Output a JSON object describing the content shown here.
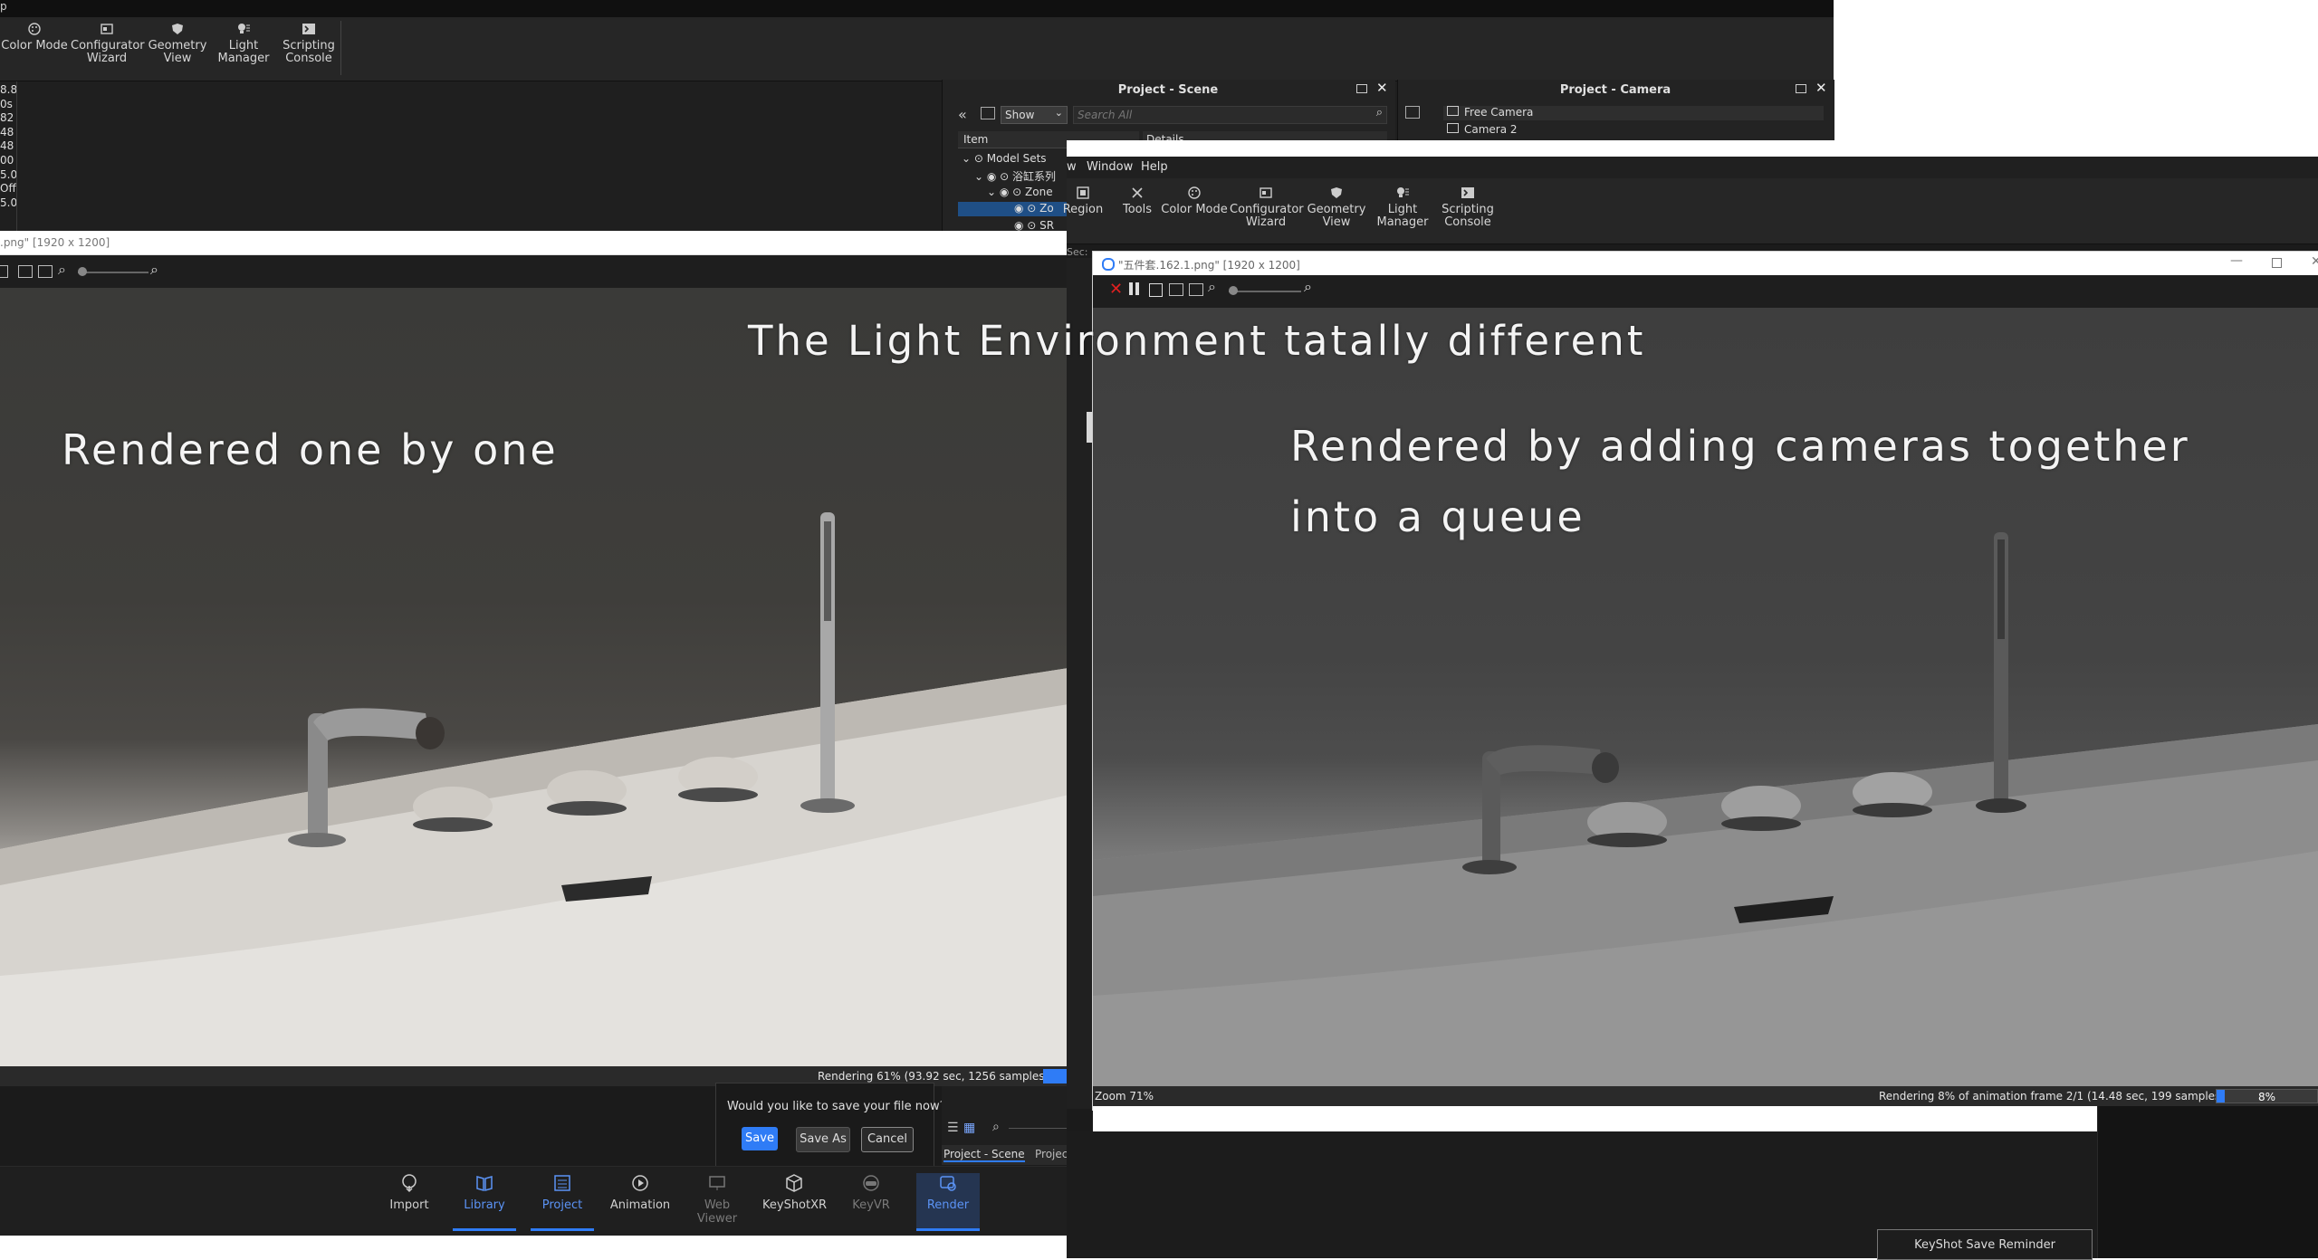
{
  "left_window": {
    "menu_fragment": "p",
    "ribbon": [
      {
        "label_1": "Color Mode",
        "label_2": "",
        "icon": "palette-icon"
      },
      {
        "label_1": "Configurator",
        "label_2": "Wizard",
        "icon": "wizard-icon"
      },
      {
        "label_1": "Geometry",
        "label_2": "View",
        "icon": "shield-icon"
      },
      {
        "label_1": "Light",
        "label_2": "Manager",
        "icon": "light-icon"
      },
      {
        "label_1": "Scripting",
        "label_2": "Console",
        "icon": "console-icon"
      }
    ],
    "side_values": [
      "8.8",
      "0s",
      "82",
      "48",
      "48",
      "00",
      "5.0",
      "Off",
      "5.0"
    ],
    "project_scene_title": "Project - Scene",
    "project_camera_title": "Project - Camera",
    "scene_show_label": "Show",
    "scene_search_placeholder": "Search All",
    "scene_item_header": "Item",
    "scene_details_header": "Details",
    "scene_tree": [
      "Model Sets",
      "浴缸系列",
      "Zone",
      "Zo",
      "SR"
    ],
    "camera_list": [
      "Free Camera",
      "Camera 2"
    ],
    "render_title": ".png\" [1920 x 1200]",
    "status_text": "Rendering 61% (93.92 sec, 1256 samples)",
    "save_prompt": "Would you like to save your file now?",
    "save_btn": "Save",
    "save_as_btn": "Save As",
    "cancel_btn": "Cancel",
    "tabs_label_scene": "Project - Scene",
    "tabs_label_proj": "Projec",
    "bottom_tabs": [
      {
        "label": "Import",
        "icon": "import-icon",
        "active": false
      },
      {
        "label": "Library",
        "icon": "book-icon",
        "active": true
      },
      {
        "label": "Project",
        "icon": "list-icon",
        "active": true
      },
      {
        "label": "Animation",
        "icon": "play-icon",
        "active": false
      },
      {
        "label": "Web Viewer",
        "icon": "monitor-icon",
        "active": false
      },
      {
        "label": "KeyShotXR",
        "icon": "cube-icon",
        "active": false
      },
      {
        "label": "KeyVR",
        "icon": "vr-icon",
        "active": false
      },
      {
        "label": "Render",
        "icon": "render-icon",
        "active": true
      }
    ]
  },
  "right_window": {
    "menu": [
      "w",
      "Window",
      "Help"
    ],
    "ribbon": [
      {
        "label_1": "Region",
        "label_2": "",
        "icon": "region-icon"
      },
      {
        "label_1": "Tools",
        "label_2": "",
        "icon": "tools-icon"
      },
      {
        "label_1": "Color Mode",
        "label_2": "",
        "icon": "palette-icon"
      },
      {
        "label_1": "Configurator",
        "label_2": "Wizard",
        "icon": "wizard-icon"
      },
      {
        "label_1": "Geometry",
        "label_2": "View",
        "icon": "shield-icon"
      },
      {
        "label_1": "Light",
        "label_2": "Manager",
        "icon": "light-icon"
      },
      {
        "label_1": "Scripting",
        "label_2": "Console",
        "icon": "console-icon"
      }
    ],
    "side_fragment": "Sec:",
    "render_title": "\"五件套.162.1.png\" [1920 x 1200]",
    "zoom_text": "Zoom 71%",
    "status_text": "Rendering 8% of animation frame 2/1 (14.48 sec, 199 samples)",
    "progress_text": "8%",
    "progress_value": 0.08,
    "save_reminder": "KeyShot Save Reminder"
  },
  "overlay": {
    "headline": "The Light Environment tatally different",
    "left_caption": "Rendered one by one",
    "right_caption_1": "Rendered by adding cameras together",
    "right_caption_2": "into a queue"
  },
  "colors": {
    "accent": "#2f7cf6",
    "dark_bg": "#1e1e1e",
    "darker_bg": "#141414",
    "selected_row": "#1f4f86"
  }
}
